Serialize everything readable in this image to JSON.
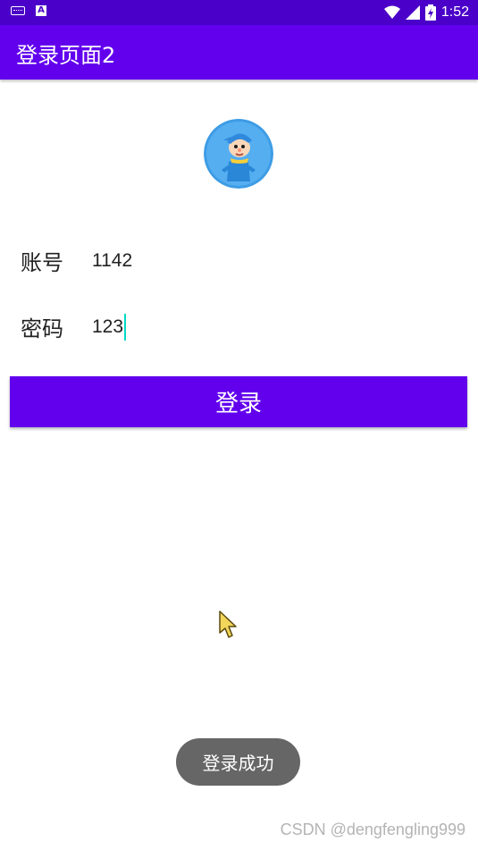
{
  "status_bar": {
    "time": "1:52",
    "icons": [
      "keyboard-icon",
      "a-icon",
      "wifi-icon",
      "signal-icon",
      "battery-charging-icon"
    ]
  },
  "app_bar": {
    "title": "登录页面2"
  },
  "avatar": {
    "icon": "cartoon-avatar"
  },
  "form": {
    "account_label": "账号",
    "account_value": "1142",
    "password_label": "密码",
    "password_value": "123"
  },
  "login_button": {
    "label": "登录"
  },
  "toast": {
    "message": "登录成功"
  },
  "watermark": {
    "text": "CSDN @dengfengling999"
  },
  "colors": {
    "status_bar": "#4a00c8",
    "primary": "#6200ee",
    "cursor": "#03dac5",
    "toast_bg": "#666666"
  }
}
